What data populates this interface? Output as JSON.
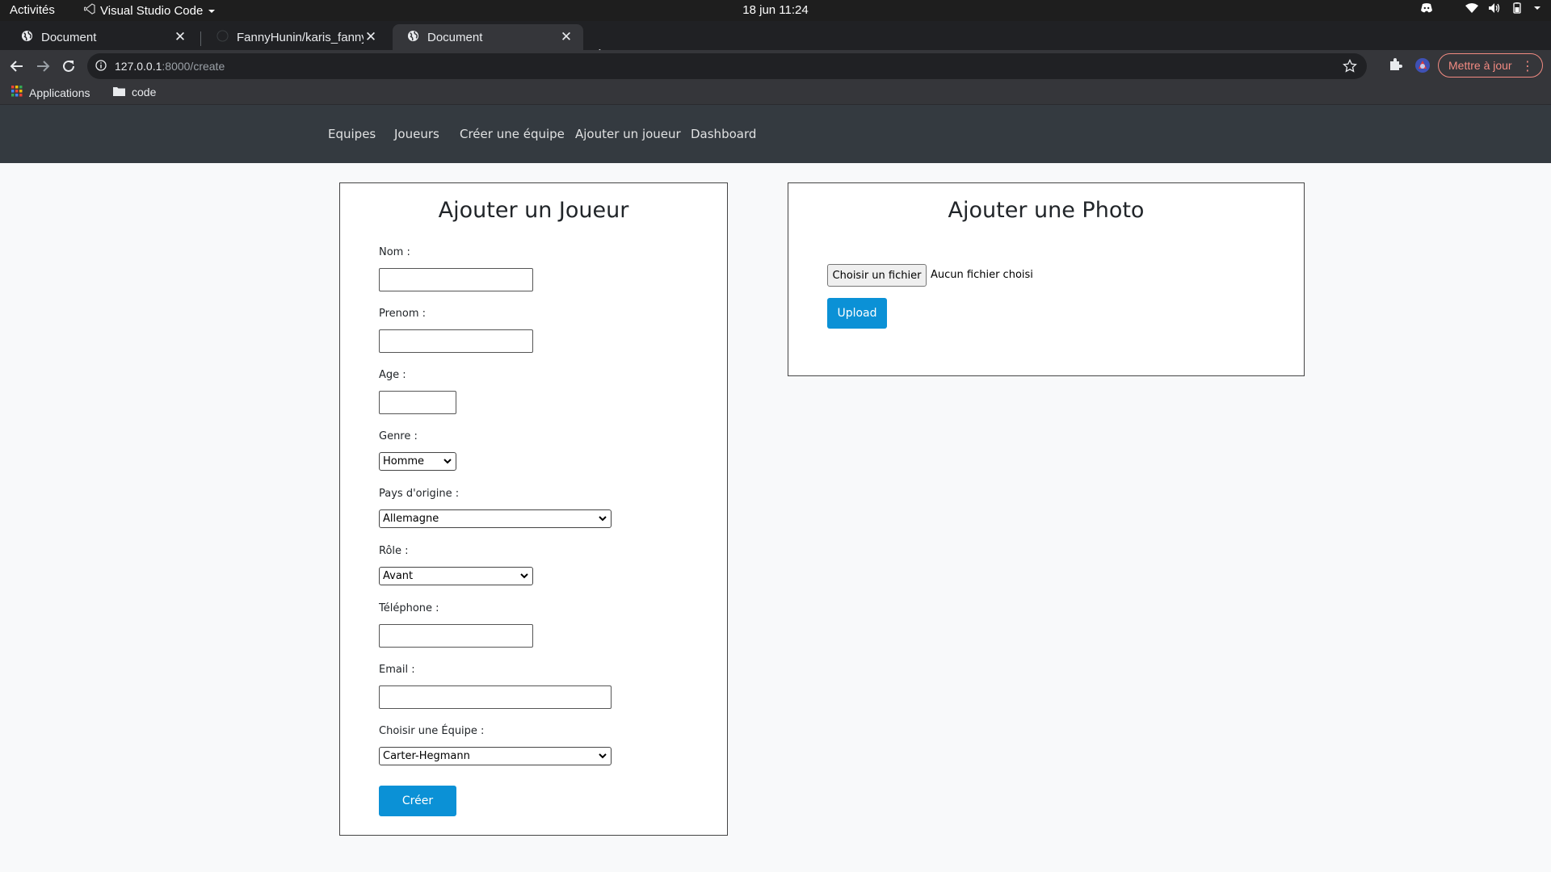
{
  "system_bar": {
    "activities": "Activités",
    "app_name": "Visual Studio Code",
    "clock": "18 jun  11:24"
  },
  "browser": {
    "tabs": [
      {
        "title": "Document",
        "active": false
      },
      {
        "title": "FannyHunin/karis_fanny_",
        "active": false
      },
      {
        "title": "Document",
        "active": true
      }
    ],
    "url_host": "127.0.0.1",
    "url_path": ":8000/create",
    "update_label": "Mettre à jour",
    "bookmarks": [
      {
        "label": "Applications",
        "icon": "apps-grid-icon"
      },
      {
        "label": "code",
        "icon": "folder-icon"
      }
    ]
  },
  "site_nav": {
    "items": [
      "Equipes",
      "Joueurs",
      "Créer une équipe",
      "Ajouter un joueur",
      "Dashboard"
    ]
  },
  "player_form": {
    "title": "Ajouter un Joueur",
    "nom_label": "Nom :",
    "prenom_label": "Prenom :",
    "age_label": "Age :",
    "genre_label": "Genre :",
    "genre_value": "Homme",
    "pays_label": "Pays d'origine :",
    "pays_value": "Allemagne",
    "role_label": "Rôle :",
    "role_value": "Avant",
    "telephone_label": "Téléphone :",
    "email_label": "Email :",
    "equipe_label": "Choisir une Équipe :",
    "equipe_value": "Carter-Hegmann",
    "submit_label": "Créer"
  },
  "photo_form": {
    "title": "Ajouter une Photo",
    "file_button_label": "Choisir un fichier",
    "file_status": "Aucun fichier choisi",
    "upload_label": "Upload"
  },
  "colors": {
    "primary_button": "#0b91d6",
    "navbar": "#343a40",
    "update_accent": "#f28b82"
  }
}
